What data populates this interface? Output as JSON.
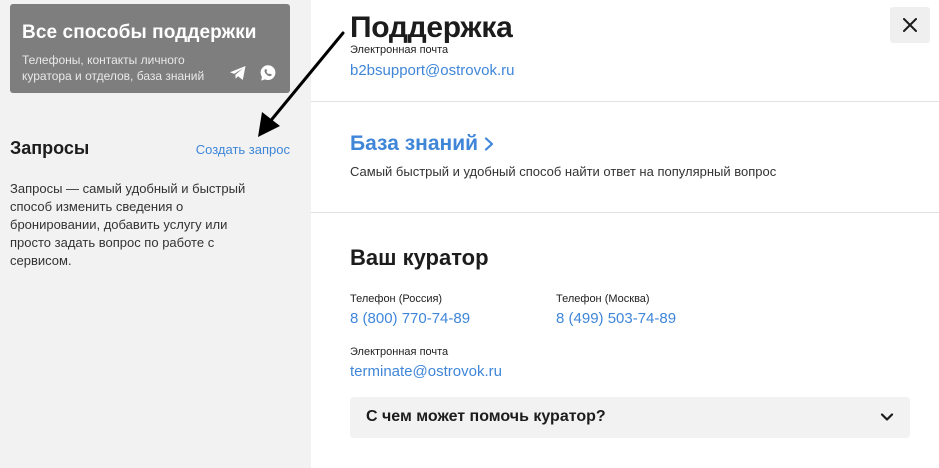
{
  "sidebar": {
    "support_card": {
      "title": "Все способы поддержки",
      "description": "Телефоны, контакты личного куратора и отделов, база знаний",
      "icons": [
        "telegram-icon",
        "whatsapp-icon"
      ]
    },
    "requests": {
      "title": "Запросы",
      "create_link": "Создать запрос",
      "text": "Запросы — самый удобный и быстрый способ изменить сведения о бронировании, добавить услугу или просто задать вопрос по работе с сервисом."
    }
  },
  "main": {
    "title": "Поддержка",
    "email_label": "Электронная почта",
    "email": "b2bsupport@ostrovok.ru",
    "knowledge_base": {
      "title": "База знаний",
      "description": "Самый быстрый и удобный способ найти ответ на популярный вопрос"
    },
    "curator": {
      "title": "Ваш куратор",
      "phone_russia_label": "Телефон (Россия)",
      "phone_russia": "8 (800) 770-74-89",
      "phone_moscow_label": "Телефон (Москва)",
      "phone_moscow": "8 (499) 503-74-89",
      "email_label": "Электронная почта",
      "email": "terminate@ostrovok.ru",
      "help_accordion": "С чем может помочь куратор?"
    }
  },
  "colors": {
    "link": "#3f86d9",
    "card_bg": "#7e7e7e",
    "sidebar_bg": "#f2f2f2"
  }
}
